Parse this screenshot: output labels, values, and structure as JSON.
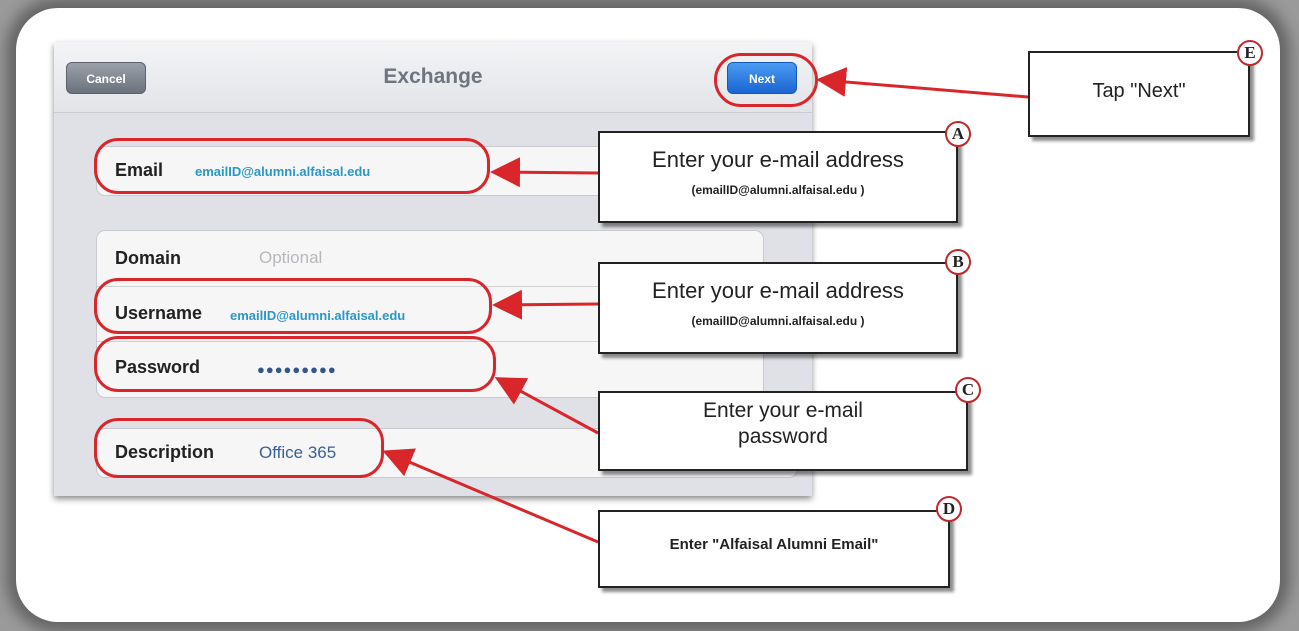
{
  "dialog": {
    "title": "Exchange",
    "cancel_label": "Cancel",
    "next_label": "Next"
  },
  "fields": {
    "email": {
      "label": "Email",
      "value": "emailID@alumni.alfaisal.edu"
    },
    "domain": {
      "label": "Domain",
      "placeholder": "Optional"
    },
    "username": {
      "label": "Username",
      "value": "emailID@alumni.alfaisal.edu"
    },
    "password": {
      "label": "Password",
      "value": "●●●●●●●●●"
    },
    "description": {
      "label": "Description",
      "value": "Office 365"
    }
  },
  "annotations": {
    "A": {
      "badge": "A",
      "line1": "Enter your e-mail address",
      "line2": "(emailID@alumni.alfaisal.edu )"
    },
    "B": {
      "badge": "B",
      "line1": "Enter your e-mail address",
      "line2": "(emailID@alumni.alfaisal.edu )"
    },
    "C": {
      "badge": "C",
      "line1": "Enter your e-mail",
      "line2": "password"
    },
    "D": {
      "badge": "D",
      "text": "Enter \"Alfaisal Alumni Email\""
    },
    "E": {
      "badge": "E",
      "text": "Tap \"Next\""
    }
  },
  "colors": {
    "callout": "#d8262b",
    "next_button": "#1a65d2",
    "field_value": "#2a97c9"
  }
}
